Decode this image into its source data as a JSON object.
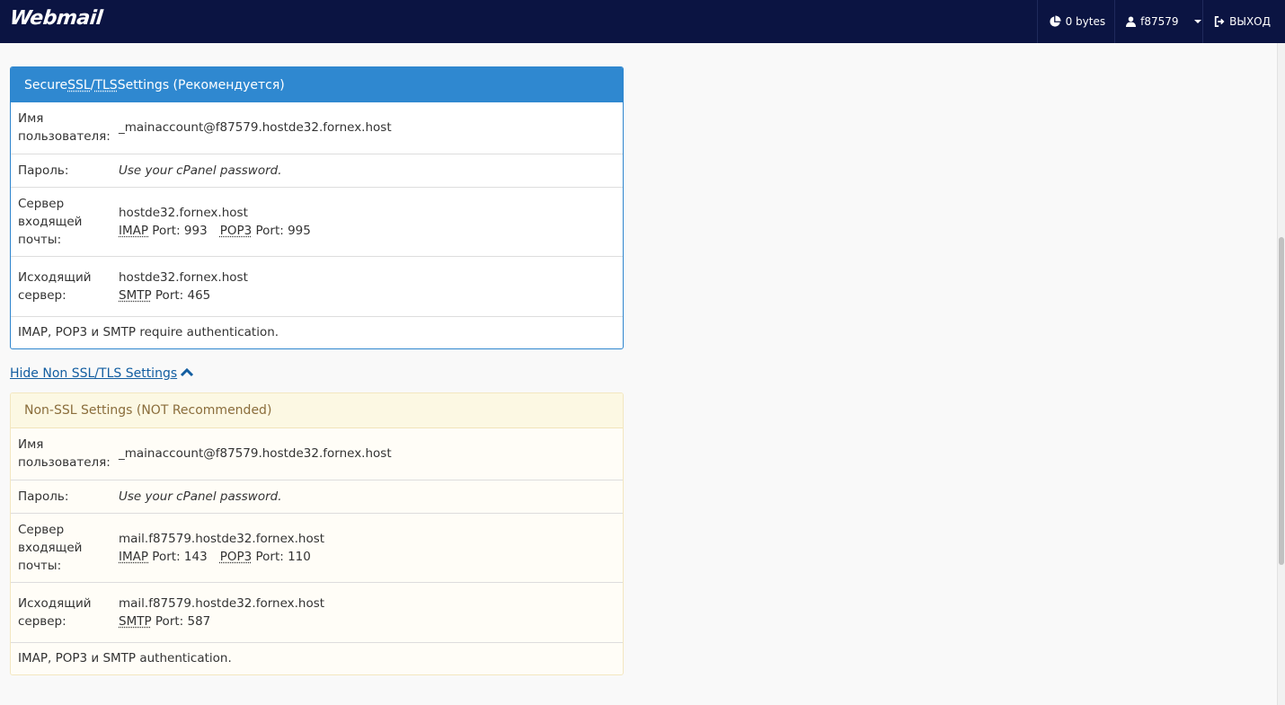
{
  "header": {
    "logo": "Webmail",
    "disk_usage": "0 bytes",
    "username": "f87579",
    "logout": "ВЫХОД",
    "icons": {
      "disk": "pie-chart-icon",
      "user": "user-icon",
      "logout": "logout-icon"
    }
  },
  "secure": {
    "heading_pre": "Secure ",
    "heading_ssl": "SSL",
    "heading_sep": "/",
    "heading_tls": "TLS",
    "heading_post": " Settings (Рекомендуется)",
    "username_label": "Имя пользователя:",
    "username": "_mainaccount@f87579.hostde32.fornex.host",
    "password_label": "Пароль:",
    "password": "Use your cPanel password.",
    "incoming_label": "Сервер входящей почты:",
    "incoming_host": "hostde32.fornex.host",
    "imap_abbr": "IMAP",
    "imap_port": " Port: 993",
    "pop3_abbr": "POP3",
    "pop3_port": " Port: 995",
    "outgoing_label": "Исходящий сервер:",
    "outgoing_host": "hostde32.fornex.host",
    "smtp_abbr": "SMTP",
    "smtp_port": " Port: 465",
    "note": "IMAP, POP3 и SMTP require authentication."
  },
  "toggle_link": "Hide Non SSL/TLS Settings",
  "nonssl": {
    "heading": "Non-SSL Settings (NOT Recommended)",
    "username_label": "Имя пользователя:",
    "username": "_mainaccount@f87579.hostde32.fornex.host",
    "password_label": "Пароль:",
    "password": "Use your cPanel password.",
    "incoming_label": "Сервер входящей почты:",
    "incoming_host": "mail.f87579.hostde32.fornex.host",
    "imap_abbr": "IMAP",
    "imap_port": " Port: 143",
    "pop3_abbr": "POP3",
    "pop3_port": " Port: 110",
    "outgoing_label": "Исходящий сервер:",
    "outgoing_host": "mail.f87579.hostde32.fornex.host",
    "smtp_abbr": "SMTP",
    "smtp_port": " Port: 587",
    "note": "IMAP, POP3 и SMTP authentication."
  },
  "colors": {
    "topbar": "#0b1442",
    "secure_heading": "#2f88d0",
    "nonssl_heading": "#fcf8e3",
    "link": "#135ea1"
  }
}
